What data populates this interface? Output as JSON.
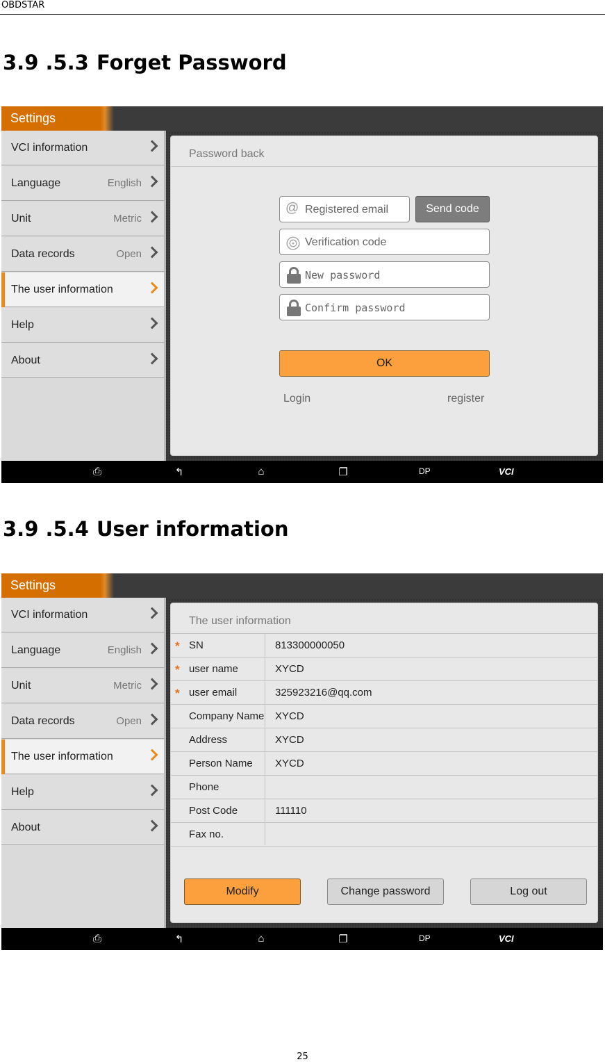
{
  "doc": {
    "header": "OBDSTAR",
    "page_number": "25"
  },
  "sections": [
    {
      "number": "3.9 .5.3",
      "title": "Forget Password"
    },
    {
      "number": "3.9 .5.4",
      "title": "User information"
    }
  ],
  "app": {
    "title": "Settings"
  },
  "sidebar": {
    "items": [
      {
        "label": "VCI information",
        "value": ""
      },
      {
        "label": "Language",
        "value": "English"
      },
      {
        "label": "Unit",
        "value": "Metric"
      },
      {
        "label": "Data records",
        "value": "Open"
      },
      {
        "label": "The user information",
        "value": ""
      },
      {
        "label": "Help",
        "value": ""
      },
      {
        "label": "About",
        "value": ""
      }
    ]
  },
  "password_back": {
    "title": "Password back",
    "email_placeholder": "Registered email",
    "send_code": "Send code",
    "code_placeholder": "Verification code",
    "new_password_placeholder": "New password",
    "confirm_password_placeholder": "Confirm password",
    "ok": "OK",
    "login": "Login",
    "register": "register"
  },
  "user_info": {
    "title": "The user information",
    "rows": [
      {
        "required": "*",
        "label": "SN",
        "value": "813300000050"
      },
      {
        "required": "*",
        "label": "user name",
        "value": "XYCD"
      },
      {
        "required": "*",
        "label": "user email",
        "value": "325923216@qq.com"
      },
      {
        "required": "",
        "label": "Company Name",
        "value": "XYCD"
      },
      {
        "required": "",
        "label": "Address",
        "value": "XYCD"
      },
      {
        "required": "",
        "label": "Person Name",
        "value": "XYCD"
      },
      {
        "required": "",
        "label": "Phone",
        "value": ""
      },
      {
        "required": "",
        "label": "Post Code",
        "value": "111110"
      },
      {
        "required": "",
        "label": "Fax no.",
        "value": ""
      }
    ],
    "modify": "Modify",
    "change_password": "Change password",
    "log_out": "Log out"
  },
  "navbar": {
    "icons": [
      "printer-icon",
      "back-icon",
      "home-icon",
      "recent-apps-icon"
    ],
    "dp": "DP",
    "vci": "VCI"
  },
  "colors": {
    "accent": "#d66f00",
    "button_orange": "#fca03d",
    "active_marker": "#e98a1a"
  }
}
